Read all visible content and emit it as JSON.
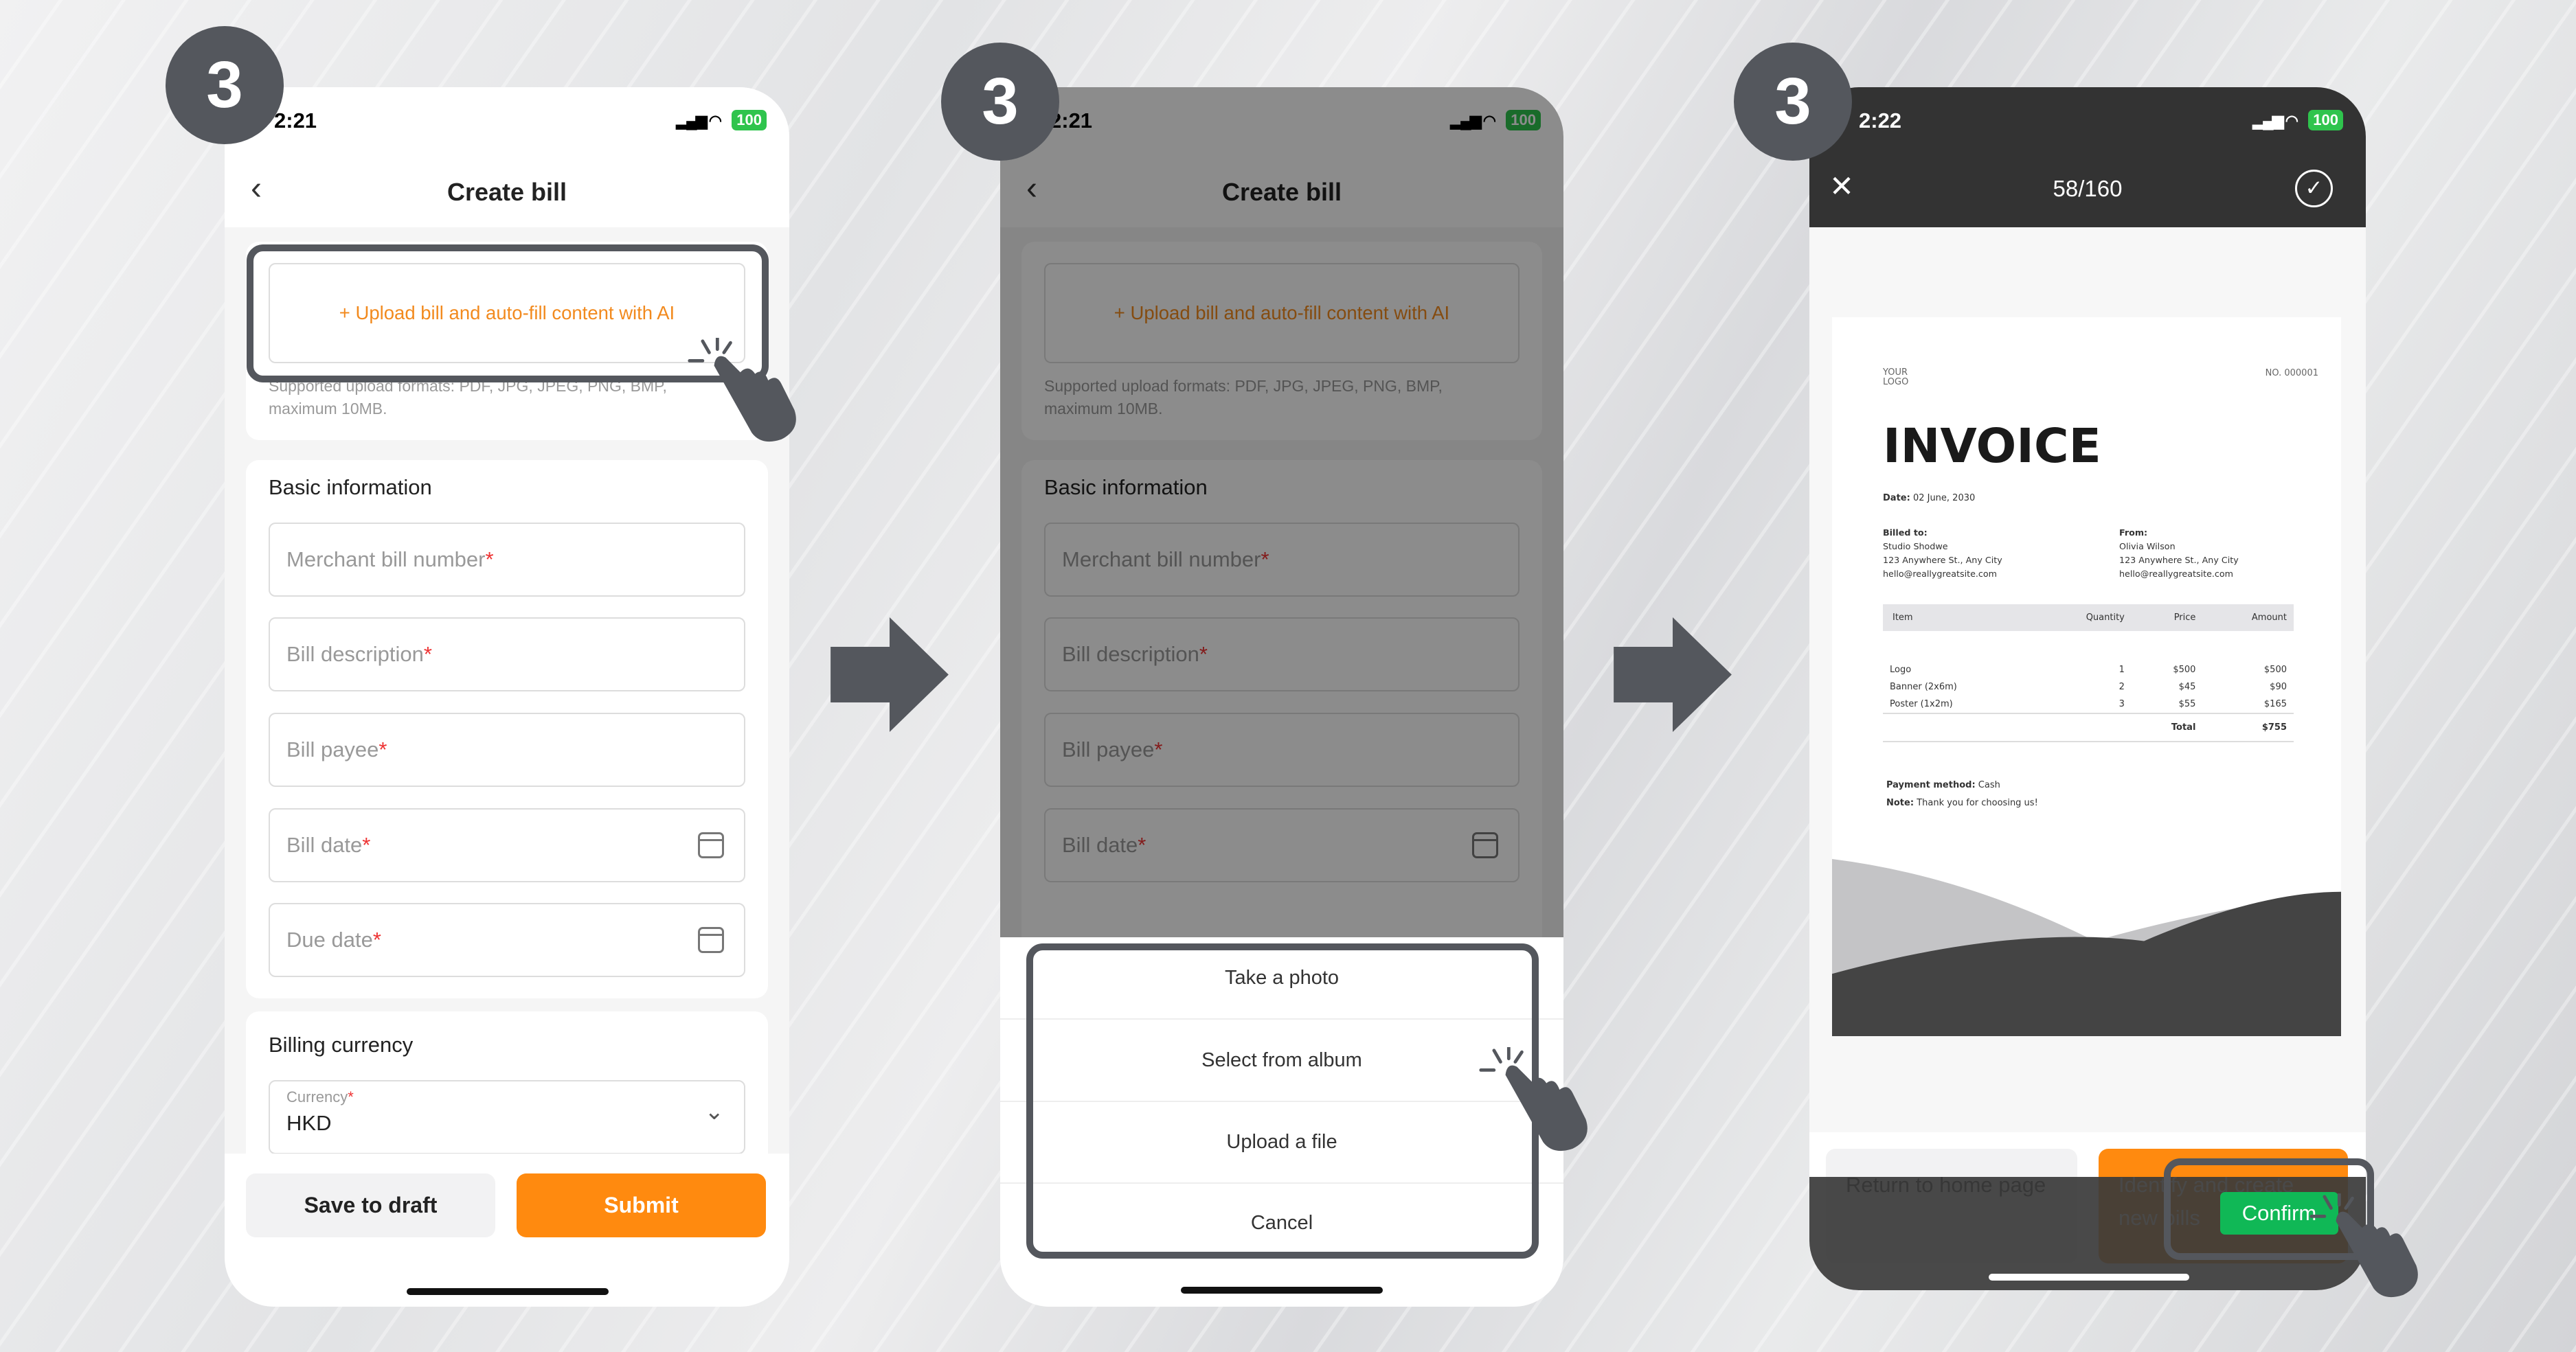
{
  "step_badge": "3",
  "colors": {
    "accent_orange": "#ff8a0f",
    "confirm_green": "#10b856",
    "badge": "#54575d"
  },
  "phone1": {
    "status": {
      "time": "2:21",
      "battery": "100"
    },
    "header": {
      "title": "Create bill",
      "back_icon": "chevron-left-icon"
    },
    "upload": {
      "label": "+ Upload bill and auto-fill content with AI",
      "hint": "Supported upload formats: PDF, JPG, JPEG, PNG, BMP, maximum 10MB."
    },
    "basic_info": {
      "title": "Basic information",
      "fields": [
        {
          "placeholder": "Merchant bill number",
          "required": "*"
        },
        {
          "placeholder": "Bill description",
          "required": "*"
        },
        {
          "placeholder": "Bill payee",
          "required": "*"
        },
        {
          "placeholder": "Bill date",
          "required": "*",
          "icon": "calendar-icon"
        },
        {
          "placeholder": "Due date",
          "required": "*",
          "icon": "calendar-icon"
        }
      ]
    },
    "billing_currency": {
      "title": "Billing currency",
      "label": "Currency",
      "required": "*",
      "value": "HKD"
    },
    "buttons": {
      "draft": "Save to draft",
      "submit": "Submit"
    }
  },
  "phone2": {
    "status": {
      "time": "2:21",
      "battery": "100"
    },
    "header": {
      "title": "Create bill"
    },
    "upload": {
      "label": "+ Upload bill and auto-fill content with AI",
      "hint": "Supported upload formats: PDF, JPG, JPEG, PNG, BMP, maximum 10MB."
    },
    "basic_info": {
      "title": "Basic information",
      "fields": [
        "Merchant bill number",
        "Bill description",
        "Bill payee",
        "Bill date"
      ]
    },
    "sheet": [
      "Take a photo",
      "Select from album",
      "Upload a file",
      "Cancel"
    ]
  },
  "phone3": {
    "status": {
      "time": "2:22",
      "battery": "100"
    },
    "header": {
      "counter": "58/160",
      "close_icon": "close-icon",
      "confirm_icon": "check-circle-icon"
    },
    "invoice": {
      "logo": "YOUR LOGO",
      "number": "NO. 000001",
      "title": "INVOICE",
      "date_label": "Date:",
      "date": "02 June, 2030",
      "billed_to": {
        "label": "Billed to:",
        "name": "Studio Shodwe",
        "address": "123 Anywhere St., Any City",
        "email": "hello@reallygreatsite.com"
      },
      "from": {
        "label": "From:",
        "name": "Olivia Wilson",
        "address": "123 Anywhere St., Any City",
        "email": "hello@reallygreatsite.com"
      },
      "columns": [
        "Item",
        "Quantity",
        "Price",
        "Amount"
      ],
      "rows": [
        [
          "Logo",
          "1",
          "$500",
          "$500"
        ],
        [
          "Banner (2x6m)",
          "2",
          "$45",
          "$90"
        ],
        [
          "Poster (1x2m)",
          "3",
          "$55",
          "$165"
        ]
      ],
      "total_label": "Total",
      "total": "$755",
      "payment_label": "Payment method:",
      "payment": "Cash",
      "note_label": "Note:",
      "note": "Thank you for choosing us!"
    },
    "buttons": {
      "return": "Return to home page",
      "identify": "Identify and create new bills",
      "confirm": "Confirm"
    }
  }
}
